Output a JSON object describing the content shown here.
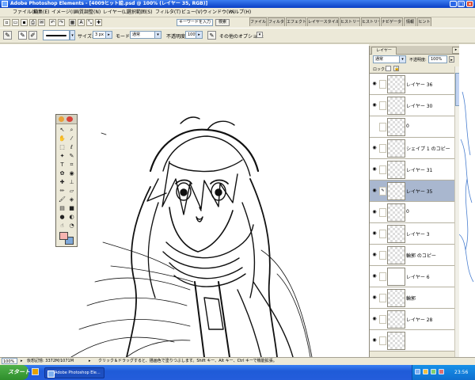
{
  "titlebar": {
    "title": "Adobe Photoshop Elements - [4009ヒット絵.psd @ 100% (レイヤー 35, RGB)]",
    "minimize": "_",
    "maximize": "□",
    "close": "×"
  },
  "menu": {
    "items": [
      "ファイル(F)",
      "編集(E)",
      "イメージ(I)",
      "画質調整(N)",
      "レイヤー(L)",
      "選択範囲(S)",
      "フィルタ(T)",
      "ビュー(V)",
      "ウィンドウ(W)",
      "ヘルプ(H)"
    ],
    "search_placeholder": "キーワードを入力",
    "go_label": "検索"
  },
  "palette_tabs": [
    "ファイル",
    "フィルタ",
    "エフェクト",
    "レイヤースタイル",
    "ヒストリー",
    "ヒストリー",
    "ナビゲーター",
    "情報",
    "ヒント"
  ],
  "options": {
    "size_label": "サイズ:",
    "size_value": "3 px",
    "mode_label": "モード:",
    "mode_value": "通常",
    "opacity_label": "不透明度:",
    "opacity_value": "100%",
    "other_label": "その他のオプション:"
  },
  "layers_panel": {
    "tab_label": "レイヤー",
    "blend_mode": "通常",
    "opacity_label": "不透明度:",
    "opacity_value": "100%",
    "lock_label": "ロック:",
    "layers": [
      {
        "name": "レイヤー 36",
        "visible": true,
        "selected": false,
        "thumb": "transparent"
      },
      {
        "name": "レイヤー 30",
        "visible": true,
        "selected": false,
        "thumb": "transparent"
      },
      {
        "name": "0",
        "visible": false,
        "selected": false,
        "thumb": "transparent"
      },
      {
        "name": "シェイプ 1 のコピー",
        "visible": true,
        "selected": false,
        "thumb": "transparent"
      },
      {
        "name": "レイヤー 31",
        "visible": true,
        "selected": false,
        "thumb": "transparent"
      },
      {
        "name": "レイヤー 35",
        "visible": true,
        "selected": true,
        "thumb": "transparent"
      },
      {
        "name": "0",
        "visible": true,
        "selected": false,
        "thumb": "transparent"
      },
      {
        "name": "レイヤー 3",
        "visible": true,
        "selected": false,
        "thumb": "transparent"
      },
      {
        "name": "輪郭 のコピー",
        "visible": true,
        "selected": false,
        "thumb": "transparent"
      },
      {
        "name": "レイヤー 6",
        "visible": true,
        "selected": false,
        "thumb": "white"
      },
      {
        "name": "輪郭",
        "visible": true,
        "selected": false,
        "thumb": "transparent"
      },
      {
        "name": "レイヤー 28",
        "visible": true,
        "selected": false,
        "thumb": "transparent"
      },
      {
        "name": "",
        "visible": true,
        "selected": false,
        "thumb": "transparent"
      }
    ]
  },
  "statusbar": {
    "zoom": "100%",
    "doc_size": "仮想記憶: 3372M/1071M",
    "hint": "クリック＆ドラッグすると、描画色で塗りつぶします。Shift キー、Alt キー、Ctrl キーで機能拡張。"
  },
  "taskbar": {
    "start_label": "スタート",
    "task_label": "Adobe Photoshop Ele...",
    "clock": "23:56"
  },
  "colors": {
    "foreground": "#f7b4b0",
    "background": "#7fa8d8",
    "selection": "#a9b7cf"
  }
}
